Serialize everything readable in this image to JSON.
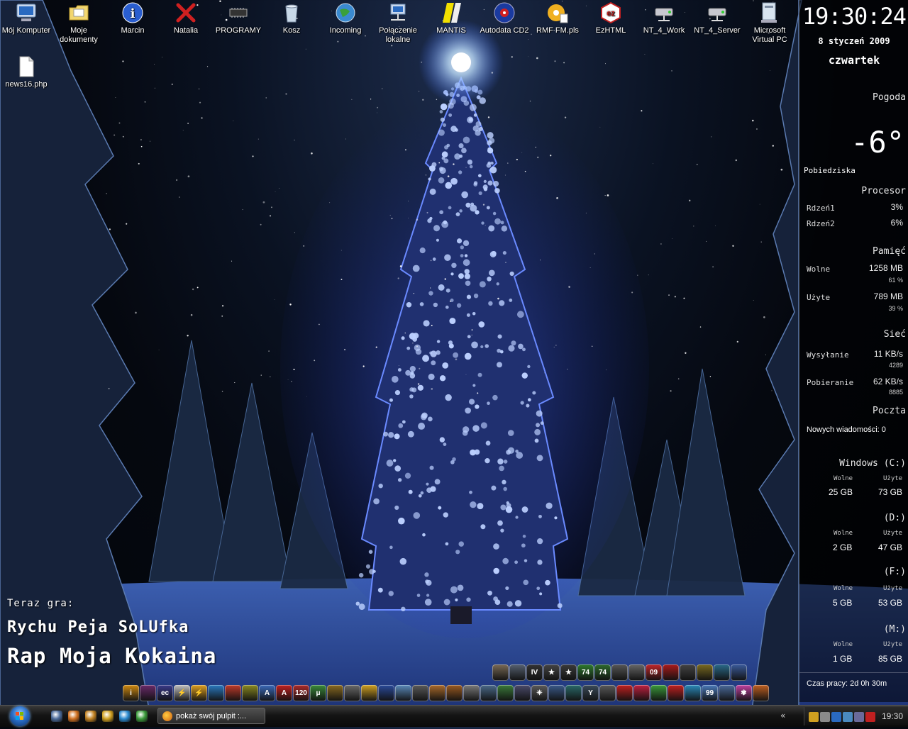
{
  "desktop": {
    "icons": [
      {
        "label": "Mój Komputer",
        "icon": "computer-icon"
      },
      {
        "label": "Moje dokumenty",
        "icon": "folder-icon"
      },
      {
        "label": "Marcin",
        "icon": "info-icon"
      },
      {
        "label": "Natalia",
        "icon": "red-x-icon"
      },
      {
        "label": "PROGRAMY",
        "icon": "chip-icon"
      },
      {
        "label": "Kosz",
        "icon": "trash-icon"
      },
      {
        "label": "Incoming",
        "icon": "globe-icon"
      },
      {
        "label": "Połączenie lokalne",
        "icon": "network-icon"
      },
      {
        "label": "MANTIS",
        "icon": "mantis-icon"
      },
      {
        "label": "Autodata CD2",
        "icon": "autodata-icon"
      },
      {
        "label": "RMF FM.pls",
        "icon": "playlist-icon"
      },
      {
        "label": "EzHTML",
        "icon": "ezhtml-icon"
      },
      {
        "label": "NT_4_Work",
        "icon": "network-drive-icon"
      },
      {
        "label": "NT_4_Server",
        "icon": "network-drive-icon"
      },
      {
        "label": "Microsoft Virtual PC",
        "icon": "virtual-pc-icon"
      },
      {
        "label": "news16.php",
        "icon": "file-icon"
      }
    ]
  },
  "sidebar": {
    "clock": "19:30:24",
    "date": "8 styczeń 2009",
    "weekday": "czwartek",
    "weather": {
      "heading": "Pogoda",
      "temperature": "-6°",
      "city": "Pobiedziska"
    },
    "cpu": {
      "heading": "Procesor",
      "rows": [
        {
          "label": "Rdzeń1",
          "value": "3%"
        },
        {
          "label": "Rdzeń2",
          "value": "6%"
        }
      ]
    },
    "memory": {
      "heading": "Pamięć",
      "free": {
        "label": "Wolne",
        "value": "1258 MB",
        "percent": "61 %"
      },
      "used": {
        "label": "Użyte",
        "value": "789 MB",
        "percent": "39 %"
      }
    },
    "network": {
      "heading": "Sieć",
      "upload": {
        "label": "Wysyłanie",
        "value": "11 KB/s",
        "total": "4289"
      },
      "download": {
        "label": "Pobieranie",
        "value": "62 KB/s",
        "total": "8885"
      }
    },
    "mail": {
      "heading": "Poczta",
      "message": "Nowych wiadomości: 0"
    },
    "drives": [
      {
        "name": "Windows (C:)",
        "free_label": "Wolne",
        "used_label": "Użyte",
        "free": "25 GB",
        "used": "73 GB"
      },
      {
        "name": "(D:)",
        "free_label": "Wolne",
        "used_label": "Użyte",
        "free": "2 GB",
        "used": "47 GB"
      },
      {
        "name": "(F:)",
        "free_label": "Wolne",
        "used_label": "Użyte",
        "free": "5 GB",
        "used": "53 GB"
      },
      {
        "name": "(M:)",
        "free_label": "Wolne",
        "used_label": "Użyte",
        "free": "1 GB",
        "used": "85 GB"
      }
    ],
    "uptime": "Czas pracy: 2d 0h 30m"
  },
  "now_playing": {
    "label": "Teraz gra:",
    "artist": "Rychu Peja SoLUfka",
    "title": "Rap Moja Kokaina"
  },
  "dock": {
    "row1": [
      {
        "icon": "truck-icon",
        "color": "#7a6a55",
        "text": ""
      },
      {
        "icon": "truck2-icon",
        "color": "#556070",
        "text": ""
      },
      {
        "icon": "gta-iv-icon",
        "color": "#333333",
        "text": "IV"
      },
      {
        "icon": "star-icon",
        "color": "#444444",
        "text": "★"
      },
      {
        "icon": "star2-icon",
        "color": "#3a3a3a",
        "text": "★"
      },
      {
        "icon": "game-icon",
        "color": "#2e7a2e",
        "text": "74"
      },
      {
        "icon": "game2-icon",
        "color": "#2e6a2e",
        "text": "74"
      },
      {
        "icon": "racing-icon",
        "color": "#555555",
        "text": ""
      },
      {
        "icon": "racing2-icon",
        "color": "#666666",
        "text": ""
      },
      {
        "icon": "fifa-09-icon",
        "color": "#c0262a",
        "text": "09"
      },
      {
        "icon": "nfs-icon",
        "color": "#aa1a1a",
        "text": ""
      },
      {
        "icon": "sport-icon",
        "color": "#444444",
        "text": ""
      },
      {
        "icon": "game3-icon",
        "color": "#7a6a20",
        "text": ""
      },
      {
        "icon": "game4-icon",
        "color": "#2a6a8a",
        "text": ""
      },
      {
        "icon": "game5-icon",
        "color": "#3a5a9a",
        "text": ""
      }
    ],
    "row2": [
      {
        "icon": "info-icon",
        "color": "#d08a10",
        "text": "i"
      },
      {
        "icon": "bug-icon",
        "color": "#6a2a6a",
        "text": ""
      },
      {
        "icon": "ec-icon",
        "color": "#3a3a8a",
        "text": "ec"
      },
      {
        "icon": "lightning-icon",
        "color": "#c0c0c0",
        "text": "⚡"
      },
      {
        "icon": "lightning2-icon",
        "color": "#e0a020",
        "text": "⚡"
      },
      {
        "icon": "runner-icon",
        "color": "#2a7ac0",
        "text": ""
      },
      {
        "icon": "swirl-icon",
        "color": "#c03a2a",
        "text": ""
      },
      {
        "icon": "bars-icon",
        "color": "#8a8a20",
        "text": ""
      },
      {
        "icon": "font-icon",
        "color": "#3a6aba",
        "text": "A"
      },
      {
        "icon": "acrobat-icon",
        "color": "#c02020",
        "text": "A"
      },
      {
        "icon": "zoom-icon",
        "color": "#aa2a2a",
        "text": "120"
      },
      {
        "icon": "torrent-icon",
        "color": "#3a8a3a",
        "text": "μ"
      },
      {
        "icon": "network-icon",
        "color": "#8a6a20",
        "text": ""
      },
      {
        "icon": "notepad-icon",
        "color": "#6a6a6a",
        "text": ""
      },
      {
        "icon": "smile-icon",
        "color": "#d0a020",
        "text": ""
      },
      {
        "icon": "save-icon",
        "color": "#2a4a9a",
        "text": ""
      },
      {
        "icon": "plane-icon",
        "color": "#5a8aba",
        "text": ""
      },
      {
        "icon": "ship-icon",
        "color": "#5a5a5a",
        "text": ""
      },
      {
        "icon": "window-icon",
        "color": "#aa6a2a",
        "text": ""
      },
      {
        "icon": "doc-icon",
        "color": "#9a5a20",
        "text": ""
      },
      {
        "icon": "fan-icon",
        "color": "#7a7a7a",
        "text": ""
      },
      {
        "icon": "board-icon",
        "color": "#4a6a8a",
        "text": ""
      },
      {
        "icon": "kd-icon",
        "color": "#3a7a3a",
        "text": ""
      },
      {
        "icon": "monitor-icon",
        "color": "#4a4a6a",
        "text": ""
      },
      {
        "icon": "snowflake-icon",
        "color": "#5a5a5a",
        "text": "✳"
      },
      {
        "icon": "refresh-icon",
        "color": "#3a5a8a",
        "text": ""
      },
      {
        "icon": "molecule-icon",
        "color": "#2a6a6a",
        "text": ""
      },
      {
        "icon": "y-icon",
        "color": "#3a4a5a",
        "text": "Y"
      },
      {
        "icon": "car-icon",
        "color": "#5a5a5a",
        "text": ""
      },
      {
        "icon": "opera-icon",
        "color": "#c02020",
        "text": ""
      },
      {
        "icon": "media-icon",
        "color": "#c02040",
        "text": ""
      },
      {
        "icon": "chrome-icon",
        "color": "#3a9a3a",
        "text": ""
      },
      {
        "icon": "nero-icon",
        "color": "#c02020",
        "text": ""
      },
      {
        "icon": "camera-icon",
        "color": "#2a8aba",
        "text": ""
      },
      {
        "icon": "ie-icon",
        "color": "#4a7aba",
        "text": "99"
      },
      {
        "icon": "desktop-icon",
        "color": "#4a6a9a",
        "text": ""
      },
      {
        "icon": "flower-icon",
        "color": "#c040a0",
        "text": "✾"
      },
      {
        "icon": "paint-icon",
        "color": "#c06020",
        "text": ""
      }
    ]
  },
  "taskbar": {
    "quicklaunch": [
      {
        "icon": "show-desktop-icon",
        "color": "#4a6a9a"
      },
      {
        "icon": "firefox-icon",
        "color": "#d07020"
      },
      {
        "icon": "winamp-icon",
        "color": "#c08020"
      },
      {
        "icon": "pencil-icon",
        "color": "#d0a020"
      },
      {
        "icon": "skype-icon",
        "color": "#2a8ad0"
      },
      {
        "icon": "utorrent-icon",
        "color": "#3a9a3a"
      }
    ],
    "task_button": "pokaż swój pulpit :...",
    "tray_icons": [
      {
        "icon": "lightning-tray-icon",
        "color": "#d0a020"
      },
      {
        "icon": "search-tray-icon",
        "color": "#8a8a8a"
      },
      {
        "icon": "bluetooth-icon",
        "color": "#2a6ac0"
      },
      {
        "icon": "network-tray-icon",
        "color": "#4a8ac0"
      },
      {
        "icon": "monitor-tray-icon",
        "color": "#6a6a9a"
      },
      {
        "icon": "antivirus-icon",
        "color": "#c02020"
      }
    ],
    "clock": "19:30"
  }
}
